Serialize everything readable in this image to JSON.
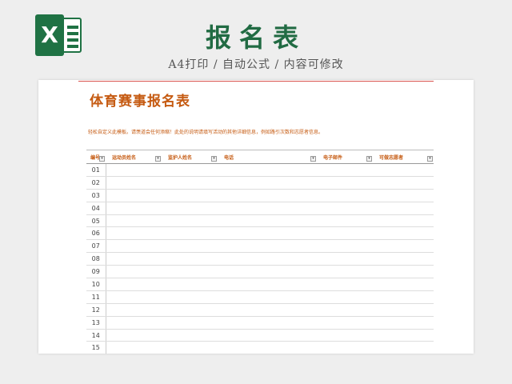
{
  "header": {
    "logo_letter": "X",
    "title": "报名表",
    "subtitle": "A4打印 / 自动公式 / 内容可修改"
  },
  "sheet": {
    "title": "体育赛事报名表",
    "description": "轻松自定义此模板。请羡道会任何添缩！此处的说明请填写活动的其他详细信息，例如路引次数和志愿者信息。",
    "columns": [
      "编号",
      "运动员姓名",
      "监护人姓名",
      "电话",
      "电子邮件",
      "可做志愿者"
    ],
    "rows": [
      "01",
      "02",
      "03",
      "04",
      "05",
      "06",
      "07",
      "08",
      "09",
      "10",
      "11",
      "12",
      "13",
      "14",
      "15"
    ]
  },
  "colors": {
    "brand_green": "#216b43",
    "accent_orange": "#c55a11"
  }
}
